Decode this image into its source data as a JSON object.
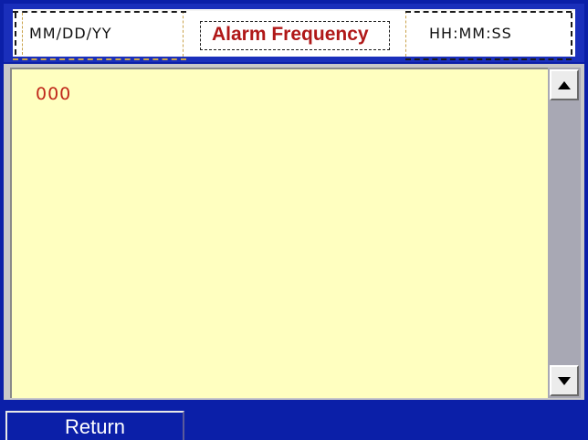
{
  "header": {
    "date_format": "MM/DD/YY",
    "title": "Alarm Frequency",
    "time_format": "HH:MM:SS"
  },
  "list": {
    "items": [
      "000"
    ]
  },
  "scrollbar": {
    "up_icon": "triangle-up-icon",
    "down_icon": "triangle-down-icon"
  },
  "footer": {
    "return_label": "Return"
  },
  "colors": {
    "background": "#0b1fa8",
    "list_background": "#ffffc0",
    "title_color": "#b01818",
    "value_color": "#c0281a"
  }
}
